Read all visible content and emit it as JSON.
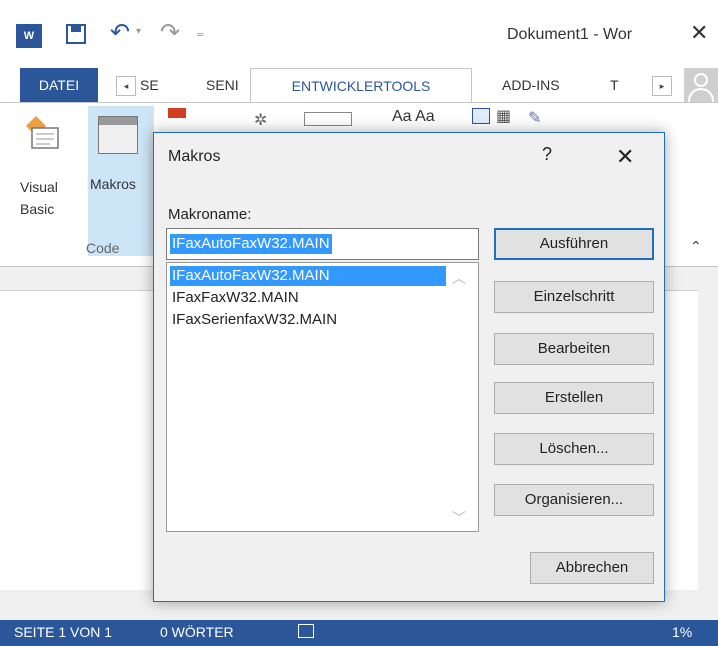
{
  "app": {
    "logo_letter": "W",
    "document_title": "Dokument1 - Wor",
    "close_glyph": "✕"
  },
  "quick_access": {
    "undo_glyph": "↶",
    "redo_glyph": "↷",
    "more_glyph": "₌"
  },
  "ribbon_tabs": {
    "datei": "DATEI",
    "scroll_left": "◂",
    "se": "SE",
    "send": "SENI",
    "entwickler": "ENTWICKLERTOOLS",
    "addins": "ADD-INS",
    "t": "T",
    "scroll_right": "▸"
  },
  "ribbon": {
    "visual_basic_line1": "Visual",
    "visual_basic_line2": "Basic",
    "makros": "Makros",
    "group_code": "Code",
    "aa": "Aa  Aa",
    "collapse_glyph": "⌃"
  },
  "dialog": {
    "title": "Makros",
    "help": "?",
    "close": "✕",
    "name_label": "Makroname:",
    "name_label_underline": "M",
    "name_value": "IFaxAutoFaxW32.MAIN",
    "macros": [
      "IFaxAutoFaxW32.MAIN",
      "IFaxFaxW32.MAIN",
      "IFaxSerienfaxW32.MAIN"
    ],
    "selected_index": 0,
    "buttons": {
      "ausfuehren": "Ausführen",
      "einzelschritt": "Einzelschritt",
      "bearbeiten": "Bearbeiten",
      "erstellen": "Erstellen",
      "loeschen": "Löschen...",
      "organisieren": "Organisieren...",
      "abbrechen": "Abbrechen"
    }
  },
  "status_bar": {
    "page": "SEITE 1 VON 1",
    "words": "0 WÖRTER",
    "zoom": "1%"
  },
  "colors": {
    "word_blue": "#2b579a",
    "selection": "#3399ff",
    "dialog_border": "#1e6fbf"
  }
}
